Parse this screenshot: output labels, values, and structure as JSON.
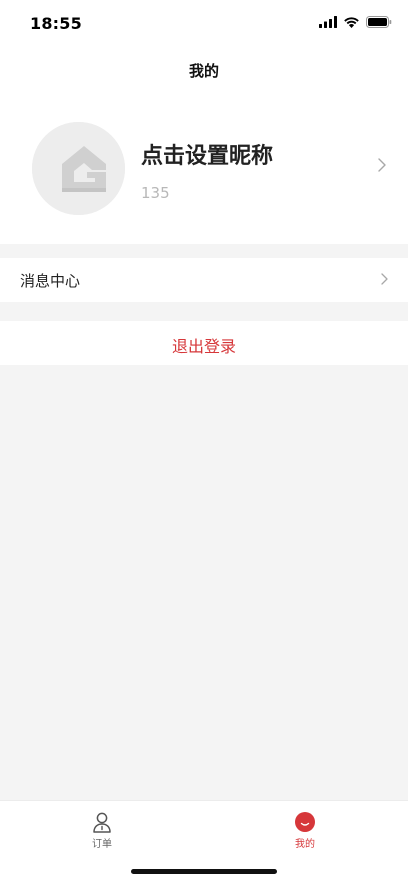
{
  "status_bar": {
    "time": "18:55",
    "icons": [
      "cellular-signal-icon",
      "wifi-icon",
      "battery-icon"
    ]
  },
  "header": {
    "title": "我的"
  },
  "profile": {
    "nickname": "点击设置昵称",
    "phone": "135",
    "avatar_icon": "default-avatar-g-logo-icon",
    "chevron_icon": "chevron-right-icon"
  },
  "menu": {
    "items": [
      {
        "label": "消息中心",
        "icon": "chevron-right-icon"
      }
    ]
  },
  "logout": {
    "label": "退出登录"
  },
  "tab_bar": {
    "tabs": [
      {
        "label": "订单",
        "icon": "user-outline-icon",
        "active": false
      },
      {
        "label": "我的",
        "icon": "smile-face-icon",
        "active": true
      }
    ]
  },
  "colors": {
    "accent": "#d6373a",
    "background": "#f4f4f4",
    "surface": "#ffffff",
    "muted_text": "#b8b8b8"
  }
}
